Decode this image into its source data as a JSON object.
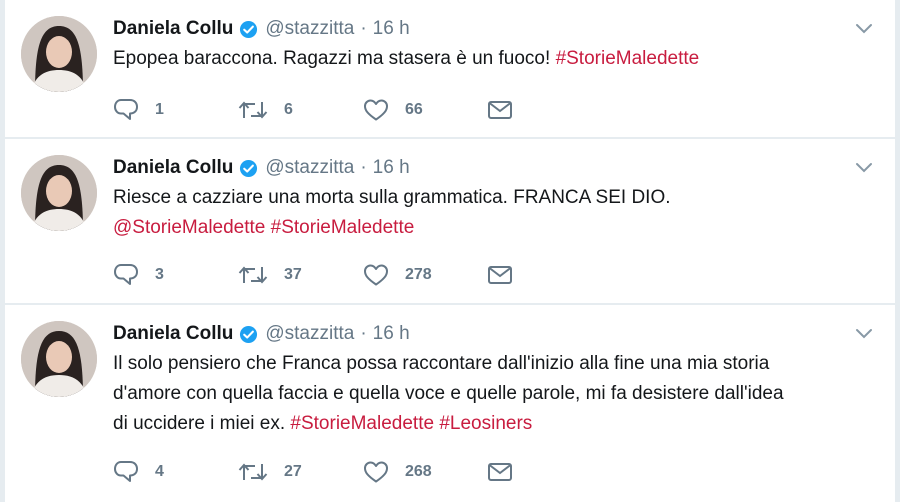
{
  "tweets": [
    {
      "author": "Daniela Collu",
      "handle": "@stazzitta",
      "separator": "·",
      "time": "16 h",
      "lines": [
        [
          {
            "t": "Epopea baraccona. Ragazzi ma stasera è un fuoco! ",
            "link": false
          },
          {
            "t": "#StorieMaledette",
            "link": true
          }
        ]
      ],
      "replies": "1",
      "retweets": "6",
      "likes": "66"
    },
    {
      "author": "Daniela Collu",
      "handle": "@stazzitta",
      "separator": "·",
      "time": "16 h",
      "lines": [
        [
          {
            "t": "Riesce a cazziare una morta sulla grammatica. FRANCA SEI DIO.",
            "link": false
          }
        ],
        [
          {
            "t": "@StorieMaledette",
            "link": true
          },
          {
            "t": " ",
            "link": false
          },
          {
            "t": "#StorieMaledette",
            "link": true
          }
        ]
      ],
      "replies": "3",
      "retweets": "37",
      "likes": "278"
    },
    {
      "author": "Daniela Collu",
      "handle": "@stazzitta",
      "separator": "·",
      "time": "16 h",
      "lines": [
        [
          {
            "t": "Il solo pensiero che Franca possa raccontare dall'inizio alla fine una mia storia",
            "link": false
          }
        ],
        [
          {
            "t": "d'amore con quella faccia e quella voce e quelle parole, mi fa desistere dall'idea",
            "link": false
          }
        ],
        [
          {
            "t": "di uccidere i miei ex. ",
            "link": false
          },
          {
            "t": "#StorieMaledette",
            "link": true
          },
          {
            "t": " ",
            "link": false
          },
          {
            "t": "#Leosiners",
            "link": true
          }
        ]
      ],
      "replies": "4",
      "retweets": "27",
      "likes": "268"
    }
  ],
  "icons": {
    "reply": "reply-icon",
    "retweet": "retweet-icon",
    "like": "heart-icon",
    "dm": "envelope-icon",
    "verified": "verified-badge-icon",
    "caret": "chevron-down-icon"
  },
  "colors": {
    "hashtag": "#c81c3f",
    "verified": "#1da1f2",
    "muted": "#657786",
    "text": "#14171a",
    "background": "#e6ecf0"
  }
}
